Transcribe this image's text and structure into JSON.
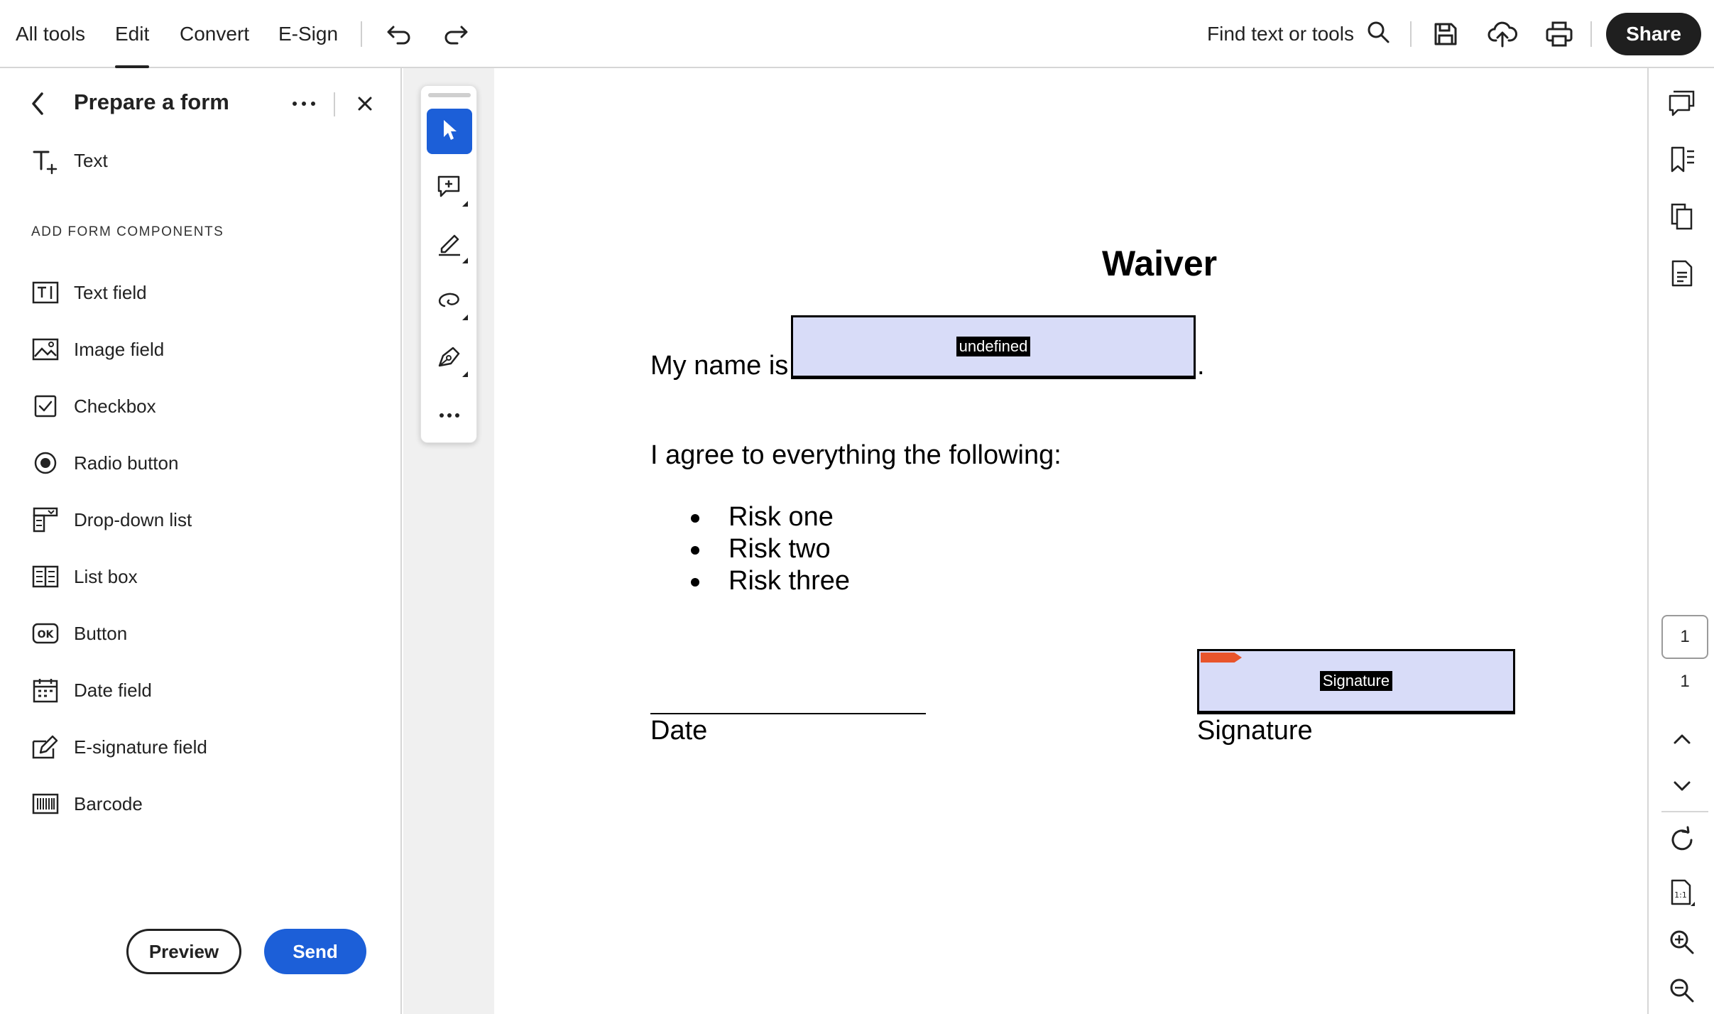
{
  "topbar": {
    "tabs": [
      {
        "label": "All tools"
      },
      {
        "label": "Edit"
      },
      {
        "label": "Convert"
      },
      {
        "label": "E-Sign"
      }
    ],
    "find_label": "Find text or tools",
    "share_label": "Share"
  },
  "left_panel": {
    "title": "Prepare a form",
    "text_tool": "Text",
    "section_heading": "ADD FORM COMPONENTS",
    "components": [
      {
        "label": "Text field",
        "icon": "text-field-icon"
      },
      {
        "label": "Image field",
        "icon": "image-field-icon"
      },
      {
        "label": "Checkbox",
        "icon": "checkbox-icon"
      },
      {
        "label": "Radio button",
        "icon": "radio-button-icon"
      },
      {
        "label": "Drop-down list",
        "icon": "dropdown-list-icon"
      },
      {
        "label": "List box",
        "icon": "list-box-icon"
      },
      {
        "label": "Button",
        "icon": "ok-button-icon"
      },
      {
        "label": "Date field",
        "icon": "date-field-icon"
      },
      {
        "label": "E-signature field",
        "icon": "e-signature-icon"
      },
      {
        "label": "Barcode",
        "icon": "barcode-icon"
      }
    ],
    "preview_label": "Preview",
    "send_label": "Send"
  },
  "document": {
    "title": "Waiver",
    "name_prefix": "My name is",
    "name_suffix": ".",
    "name_field_tag": "undefined",
    "agree_text": "I agree to everything the following:",
    "risks": [
      "Risk one",
      "Risk two",
      "Risk three"
    ],
    "date_label": "Date",
    "signature_label": "Signature",
    "signature_field_tag": "Signature"
  },
  "right_rail": {
    "current_page": "1",
    "total_pages": "1"
  },
  "colors": {
    "accent_blue": "#1c5fd8",
    "field_fill": "#d8dcf8",
    "signature_flag": "#e8542c"
  }
}
